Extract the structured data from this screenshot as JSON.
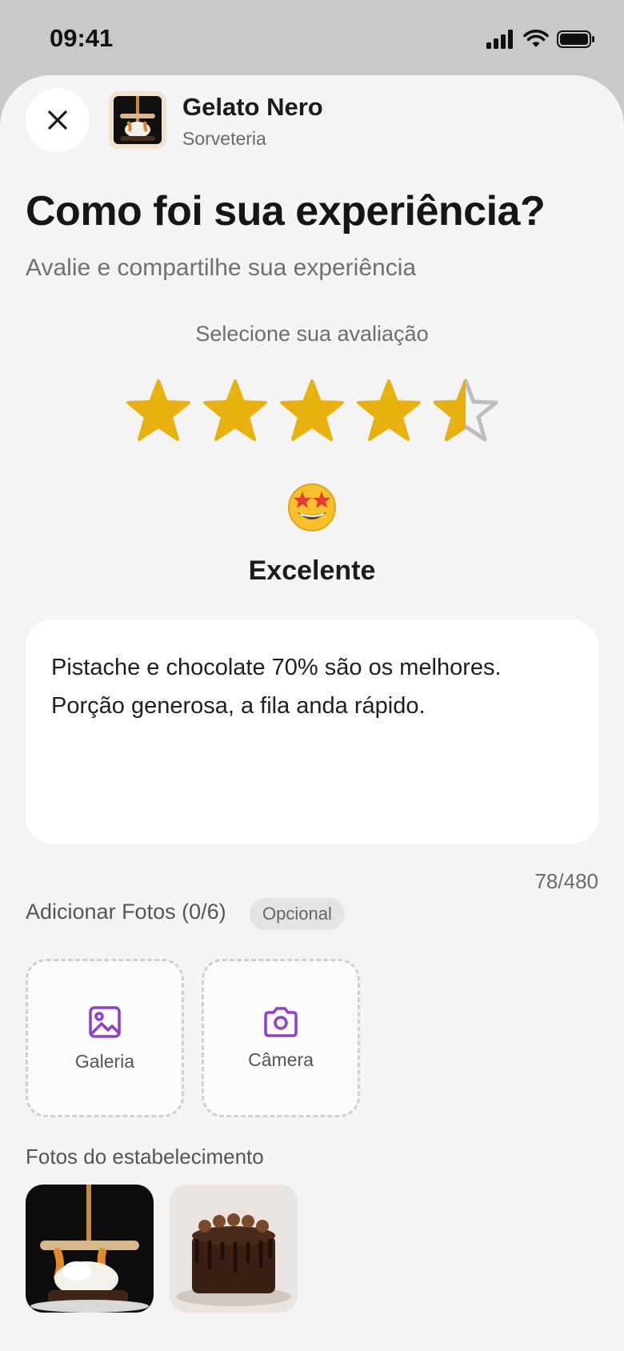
{
  "status_bar": {
    "time": "09:41"
  },
  "header": {
    "store_name": "Gelato Nero",
    "store_category": "Sorveteria"
  },
  "title": "Como foi sua experiência?",
  "subtitle": "Avalie e compartilhe sua experiência",
  "rating": {
    "label": "Selecione sua avaliação",
    "value": 4.5,
    "max": 5,
    "word": "Excelente",
    "star_color": "#E8B10E",
    "empty_star_color": "#BDBDBD"
  },
  "review": {
    "text": "Pistache e chocolate 70% são os melhores.\nPorção generosa, a fila anda rápido.",
    "char_count": "78/480"
  },
  "photos": {
    "label": "Adicionar Fotos (0/6)",
    "optional_badge": "Opcional",
    "gallery_label": "Galeria",
    "camera_label": "Câmera",
    "accent_color": "#8E3FCB"
  },
  "establishment": {
    "label": "Fotos do estabelecimento"
  }
}
